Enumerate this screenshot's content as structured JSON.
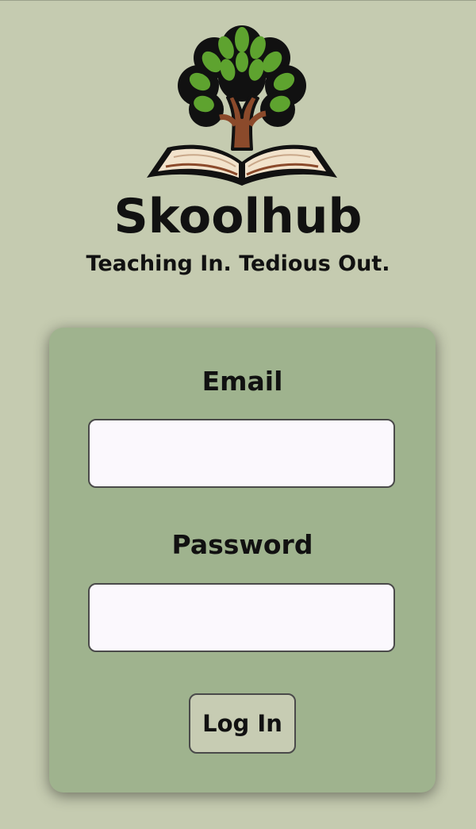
{
  "app": {
    "name": "Skoolhub",
    "tagline": "Teaching In. Tedious Out.",
    "logo_icon": "tree-on-open-book-icon"
  },
  "login_form": {
    "email_label": "Email",
    "email_value": "",
    "email_placeholder": "",
    "password_label": "Password",
    "password_value": "",
    "password_placeholder": "",
    "submit_label": "Log In"
  },
  "colors": {
    "page_background": "#c5cbb0",
    "card_background": "#9fb38e",
    "input_background": "#fbf8fd",
    "button_background": "#c7ccb3",
    "leaf_green": "#5ea32f",
    "trunk_brown": "#8b4a2b"
  }
}
